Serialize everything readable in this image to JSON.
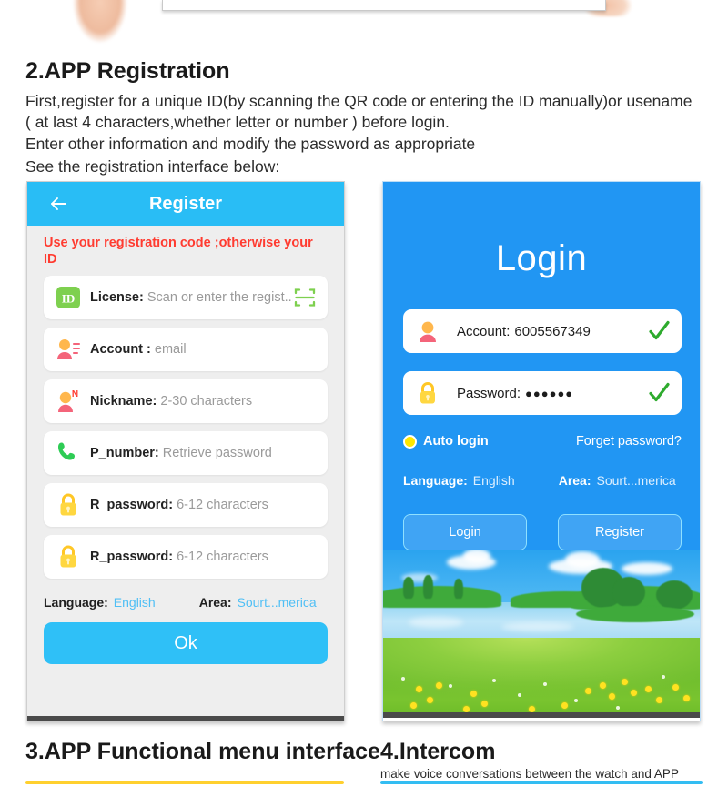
{
  "doc": {
    "section_2": {
      "heading": "2.APP Registration",
      "lines": [
        "First,register for a unique ID(by scanning the QR code or entering the ID manually)or usename",
        "( at last 4 characters,whether letter or number ) before login.",
        "Enter other information and modify the password as appropriate",
        "See the registration interface below:"
      ]
    },
    "section_3": {
      "heading": "3.APP Functional menu interface"
    },
    "section_4": {
      "heading": "4.Intercom",
      "subtext": "make voice conversations between the watch and APP"
    }
  },
  "register_screen": {
    "back_icon": "back-arrow-icon",
    "title": "Register",
    "warning": "Use your registration code ;otherwise your ID",
    "fields": [
      {
        "icon": "id-badge-icon",
        "label": "License:",
        "placeholder": "Scan or enter the regist...",
        "trailing_icon": "qr-scan-icon"
      },
      {
        "icon": "user-account-icon",
        "label": "Account :",
        "placeholder": "email",
        "trailing_icon": ""
      },
      {
        "icon": "nickname-icon",
        "label": "Nickname:",
        "placeholder": "2-30 characters",
        "trailing_icon": ""
      },
      {
        "icon": "phone-icon",
        "label": "P_number:",
        "placeholder": "Retrieve password",
        "trailing_icon": ""
      },
      {
        "icon": "lock-icon",
        "label": "R_password:",
        "placeholder": "6-12 characters",
        "trailing_icon": ""
      },
      {
        "icon": "lock-icon",
        "label": "R_password:",
        "placeholder": "6-12 characters",
        "trailing_icon": ""
      }
    ],
    "language_key": "Language:",
    "language_value": "English",
    "area_key": "Area:",
    "area_value": "Sourt...merica",
    "ok_button": "Ok"
  },
  "login_screen": {
    "title": "Login",
    "account_label": "Account:",
    "account_value": "6005567349",
    "account_valid_icon": "green-check-icon",
    "password_label": "Password:",
    "password_value": "●●●●●●",
    "password_valid_icon": "green-check-icon",
    "auto_login_label": "Auto login",
    "forget_password_label": "Forget password?",
    "language_key": "Language:",
    "language_value": "English",
    "area_key": "Area:",
    "area_value": "Sourt...merica",
    "login_button": "Login",
    "register_button": "Register"
  },
  "colors": {
    "register_header": "#29bdf5",
    "login_background": "#2196f3",
    "warning_red": "#ff3b30",
    "ok_button": "#2fc0f7",
    "accent_yellow_bar": "#ffd02e",
    "accent_blue_bar": "#33bdf2",
    "check_green": "#2eab2e",
    "lock_yellow": "#ffc726"
  }
}
